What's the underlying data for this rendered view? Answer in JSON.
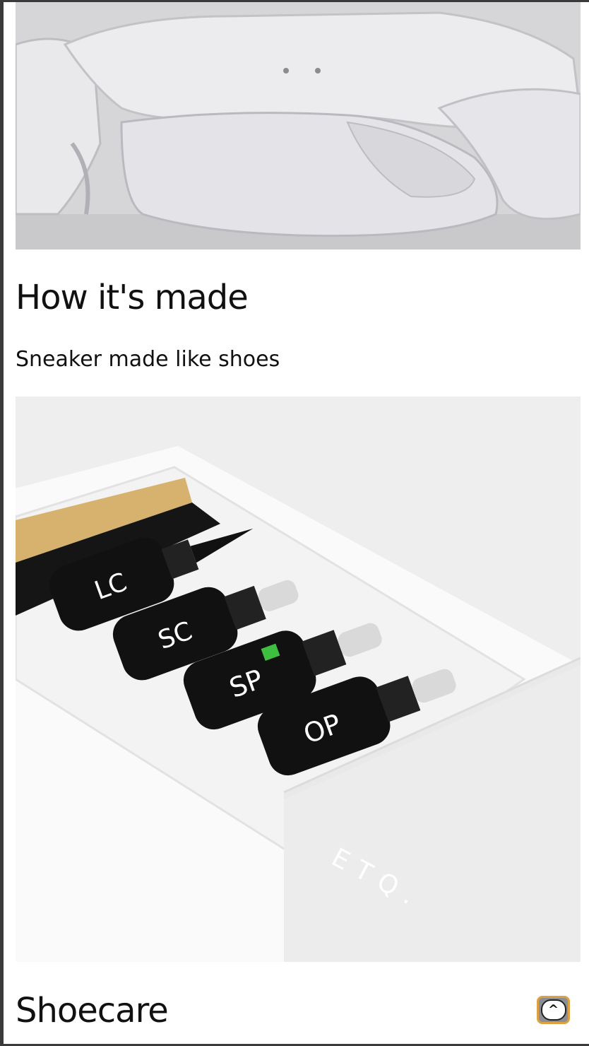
{
  "sections": [
    {
      "image_alt": "White leather sneakers in production",
      "title": "How it's made",
      "subtitle": "Sneaker made like shoes"
    },
    {
      "image_alt": "ETQ shoe care kit with brush and bottles",
      "bottle_labels": [
        "LC",
        "SC",
        "SP",
        "OP"
      ],
      "box_brand": "ETQ.",
      "title": "Shoecare"
    }
  ],
  "back_to_top": {
    "label": "^",
    "accent_color": "#e0a040"
  },
  "colors": {
    "page_bg": "#ffffff",
    "text": "#111111",
    "frame": "#3a3a3a"
  },
  "icons": {
    "back_to_top": "chevron-up-icon"
  }
}
